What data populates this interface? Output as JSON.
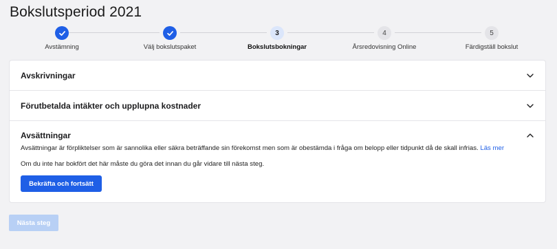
{
  "page": {
    "title": "Bokslutsperiod 2021"
  },
  "steps": [
    {
      "number": "",
      "label": "Avstämning",
      "status": "done"
    },
    {
      "number": "",
      "label": "Välj bokslutspaket",
      "status": "done"
    },
    {
      "number": "3",
      "label": "Bokslutsbokningar",
      "status": "current"
    },
    {
      "number": "4",
      "label": "Årsredovisning Online",
      "status": "todo"
    },
    {
      "number": "5",
      "label": "Färdigställ bokslut",
      "status": "todo"
    }
  ],
  "accordion": {
    "sections": [
      {
        "title": "Avskrivningar",
        "expanded": false
      },
      {
        "title": "Förutbetalda intäkter och upplupna kostnader",
        "expanded": false
      },
      {
        "title": "Avsättningar",
        "expanded": true,
        "description": "Avsättningar är förpliktelser som är sannolika eller säkra beträffande sin förekomst men som är obestämda i fråga om belopp eller tidpunkt då de skall infrias.",
        "link_text": "Läs mer",
        "note": "Om du inte har bokfört det här måste du göra det innan du går vidare till nästa steg.",
        "confirm_button": "Bekräfta och fortsätt"
      }
    ]
  },
  "footer": {
    "next_button": "Nästa steg"
  },
  "colors": {
    "accent": "#1f5fe6",
    "accent_disabled": "#b8d0f5",
    "background": "#f2f2f4"
  }
}
